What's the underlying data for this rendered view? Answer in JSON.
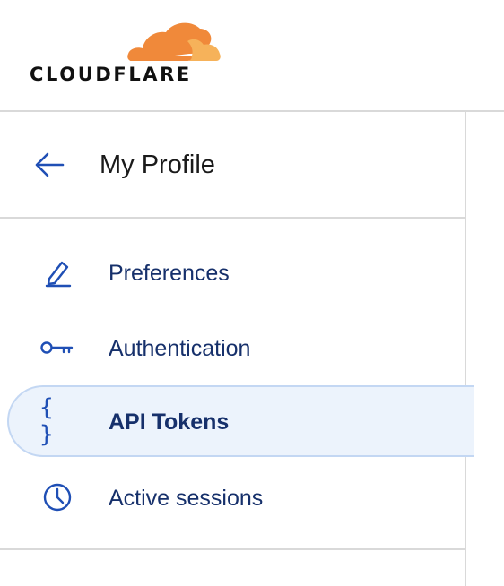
{
  "brand": {
    "name": "CLOUDFLARE",
    "colors": {
      "cloud_primary": "#f0893a",
      "cloud_secondary": "#f6b25a",
      "wordmark": "#111111"
    }
  },
  "sidebar": {
    "header": {
      "back_icon": "arrow-left-icon",
      "title": "My Profile"
    },
    "items": [
      {
        "label": "Preferences",
        "icon": "pencil-icon",
        "active": false
      },
      {
        "label": "Authentication",
        "icon": "key-icon",
        "active": false
      },
      {
        "label": "API Tokens",
        "icon": "braces-icon",
        "active": true
      },
      {
        "label": "Active sessions",
        "icon": "clock-icon",
        "active": false
      }
    ],
    "colors": {
      "accent": "#1f4fb5",
      "label": "#16306b",
      "active_background": "#ecf3fc",
      "active_border": "#c3d7f3",
      "divider": "#d9d9d9"
    }
  }
}
